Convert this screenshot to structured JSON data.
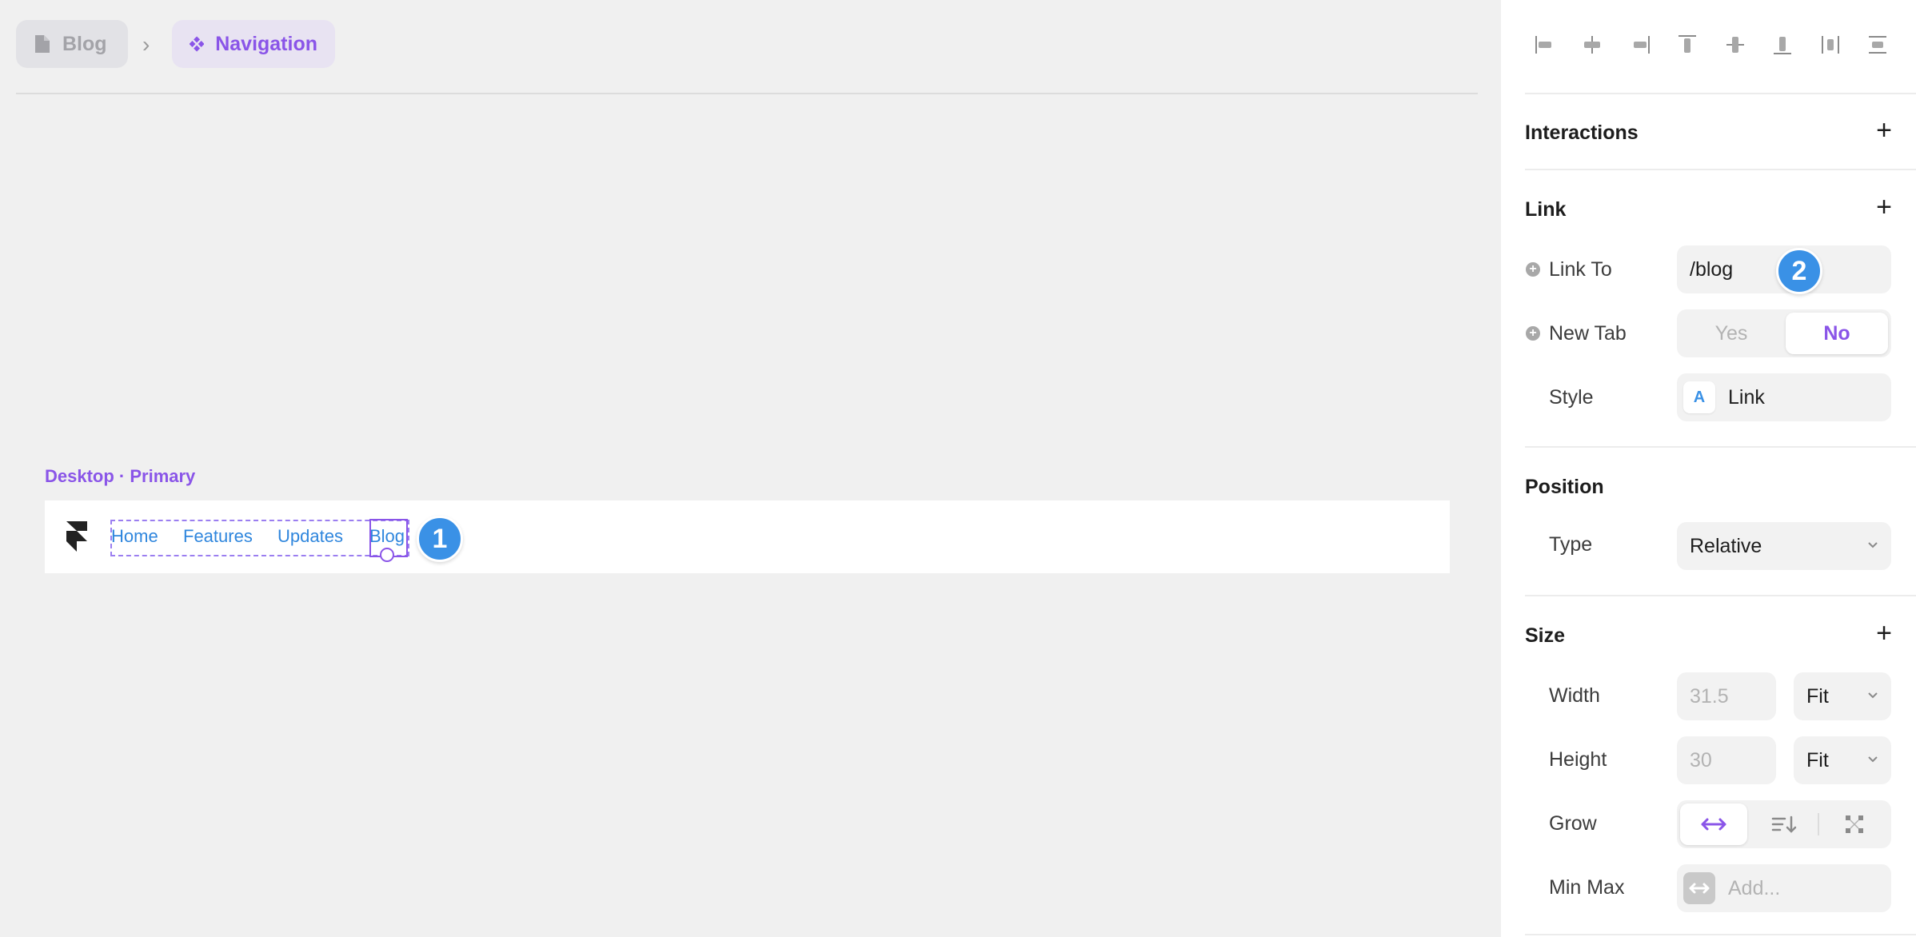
{
  "breadcrumb": {
    "page": "Blog",
    "component": "Navigation"
  },
  "canvas": {
    "frame_label": "Desktop · Primary",
    "nav_links": [
      "Home",
      "Features",
      "Updates",
      "Blog"
    ]
  },
  "badges": {
    "one": "1",
    "two": "2"
  },
  "panel": {
    "interactions": {
      "title": "Interactions",
      "add": "+"
    },
    "link": {
      "title": "Link",
      "add": "+",
      "link_to_label": "Link To",
      "link_to_value": "/blog",
      "new_tab_label": "New Tab",
      "new_tab_yes": "Yes",
      "new_tab_no": "No",
      "new_tab_selected": "No",
      "style_label": "Style",
      "style_icon": "A",
      "style_value": "Link"
    },
    "position": {
      "title": "Position",
      "type_label": "Type",
      "type_value": "Relative"
    },
    "size": {
      "title": "Size",
      "add": "+",
      "width_label": "Width",
      "width_value": "31.5",
      "width_mode": "Fit",
      "height_label": "Height",
      "height_value": "30",
      "height_mode": "Fit",
      "grow_label": "Grow",
      "minmax_label": "Min Max",
      "minmax_placeholder": "Add..."
    }
  },
  "colors": {
    "accent_purple": "#8a55e8",
    "link_blue": "#2f86dd",
    "badge_blue": "#3a91e6"
  }
}
